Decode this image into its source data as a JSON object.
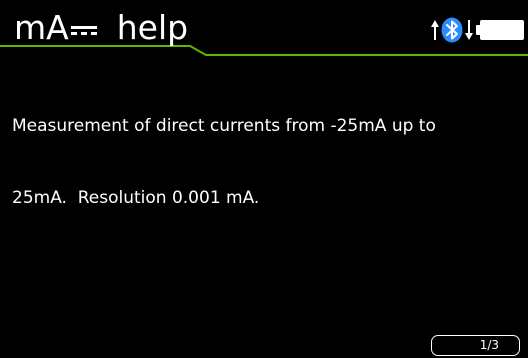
{
  "header": {
    "unit": "mA",
    "title": "help",
    "accent_color": "#5fb800",
    "status_icons": [
      "arrow-up-icon",
      "bluetooth-icon",
      "arrow-down-icon",
      "battery-icon"
    ],
    "bluetooth_color": "#2a8cff"
  },
  "help": {
    "line1": "Measurement of direct currents from -25mA up to",
    "line2": "25mA.  Resolution 0.001 mA."
  },
  "pager": {
    "label": "1/3"
  }
}
